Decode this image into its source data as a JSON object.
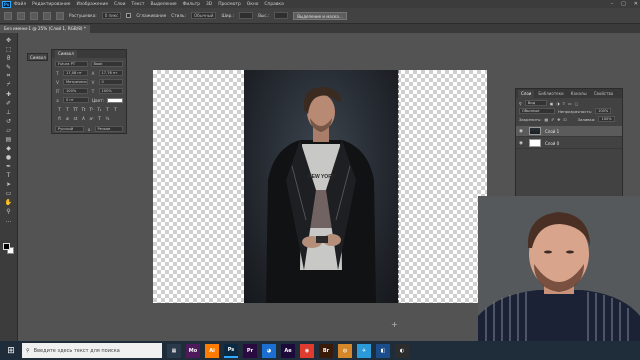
{
  "colors": {
    "ui_dark": "#3c3c3c",
    "ui_panel": "#454545",
    "workspace": "#535353",
    "ps_blue": "#31a8ff",
    "taskbar": "#1f2c3a"
  },
  "app": {
    "logo_text": "Ps",
    "window_controls": [
      "–",
      "□",
      "✕"
    ]
  },
  "menu": [
    "Файл",
    "Редактирование",
    "Изображение",
    "Слои",
    "Текст",
    "Выделение",
    "Фильтр",
    "3D",
    "Просмотр",
    "Окно",
    "Справка"
  ],
  "options": {
    "feather_label": "Растушевка:",
    "feather_value": "0 пикс",
    "antialias_label": "Сглаживание",
    "style_label": "Стиль:",
    "style_value": "Обычный",
    "width_label": "Шир.:",
    "height_label": "Выс.:",
    "select_mask_button": "Выделение и маска..."
  },
  "document": {
    "tab_title": "Без имени-1 @ 25% (Слой 1, RGB/8) *"
  },
  "tools": [
    "move-tool-icon",
    "marquee-tool-icon",
    "lasso-tool-icon",
    "quick-select-icon",
    "crop-tool-icon",
    "eyedropper-icon",
    "healing-brush-icon",
    "brush-tool-icon",
    "clone-stamp-icon",
    "history-brush-icon",
    "eraser-icon",
    "gradient-icon",
    "blur-icon",
    "dodge-icon",
    "pen-tool-icon",
    "type-tool-icon",
    "path-select-icon",
    "shape-tool-icon",
    "hand-tool-icon",
    "zoom-tool-icon"
  ],
  "character_panel": {
    "tab": "Символ",
    "mini_tab": "Символ",
    "font_family": "Futura PT",
    "font_style": "Book",
    "size": "17,08 пт",
    "leading": "17,76 пт",
    "kerning": "Метрически",
    "tracking": "0",
    "vscale": "100%",
    "hscale": "100%",
    "baseline": "0 пт",
    "color_label": "Цвет:",
    "language": "Русский",
    "aa": "Резкое"
  },
  "layers_panel": {
    "tabs": [
      "Слои",
      "Библиотеки",
      "Каналы",
      "Свойства"
    ],
    "filter_kind": "Вид",
    "blend_mode": "Обычные",
    "opacity_label": "Непрозрачность:",
    "opacity_value": "100%",
    "lock_label": "Закрепить:",
    "fill_label": "Заливка:",
    "fill_value": "100%",
    "layers": [
      {
        "name": "Слой 1",
        "selected": true
      },
      {
        "name": "Слой 0",
        "selected": false
      }
    ],
    "footer_icons": [
      "link-icon",
      "fx-icon",
      "mask-icon",
      "adjustment-icon",
      "folder-icon",
      "new-layer-icon",
      "trash-icon"
    ]
  },
  "canvas": {
    "photo_text": "NEW YORK"
  },
  "taskbar": {
    "search_placeholder": "Введите здесь текст для поиска",
    "apps": [
      {
        "label": "▦",
        "color": "#2b3a4a"
      },
      {
        "label": "Mo",
        "color": "#4e1a5c"
      },
      {
        "label": "Ai",
        "color": "#ff7c00"
      },
      {
        "label": "Ps",
        "color": "#0a2a44"
      },
      {
        "label": "Pr",
        "color": "#2a0a40"
      },
      {
        "label": "◕",
        "color": "#1b6fd1"
      },
      {
        "label": "Ae",
        "color": "#1c0a3a"
      },
      {
        "label": "◉",
        "color": "#e03b2f"
      },
      {
        "label": "Br",
        "color": "#3a1a08"
      },
      {
        "label": "◍",
        "color": "#d4882a"
      },
      {
        "label": "✈",
        "color": "#2a9ad8"
      },
      {
        "label": "◧",
        "color": "#1b4d8a"
      },
      {
        "label": "◐",
        "color": "#2d2d2d"
      }
    ]
  }
}
